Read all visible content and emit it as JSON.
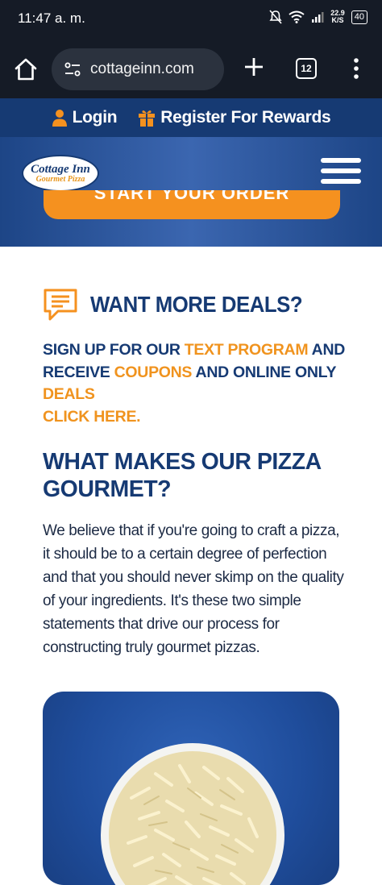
{
  "status_bar": {
    "time": "11:47 a. m.",
    "net_speed_value": "22.9",
    "net_speed_unit": "K/S",
    "battery": "40"
  },
  "browser": {
    "url": "cottageinn.com",
    "tab_count": "12"
  },
  "site_topbar": {
    "login_label": "Login",
    "rewards_label": "Register For Rewards"
  },
  "header": {
    "logo_main": "Cottage Inn",
    "logo_sub": "Gourmet Pizza",
    "order_button_label": "START YOUR ORDER"
  },
  "deals": {
    "title": "WANT MORE DEALS?",
    "text_1": "SIGN UP FOR OUR ",
    "link_text_program": "TEXT PROGRAM",
    "text_2": " AND RECEIVE ",
    "link_coupons": "COUPONS",
    "text_3": " AND ONLINE ONLY ",
    "link_deals": "DEALS",
    "link_click_here": "CLICK HERE."
  },
  "gourmet": {
    "title": "WHAT MAKES OUR PIZZA GOURMET?",
    "body": "We believe that if you're going to craft a pizza, it should be to a certain degree of perfection and that you should never skimp on the quality of your ingredients. It's these two simple statements that drive our process for constructing truly gourmet pizzas."
  },
  "colors": {
    "navy": "#163a73",
    "orange": "#f5911f",
    "chrome": "#151b26"
  }
}
